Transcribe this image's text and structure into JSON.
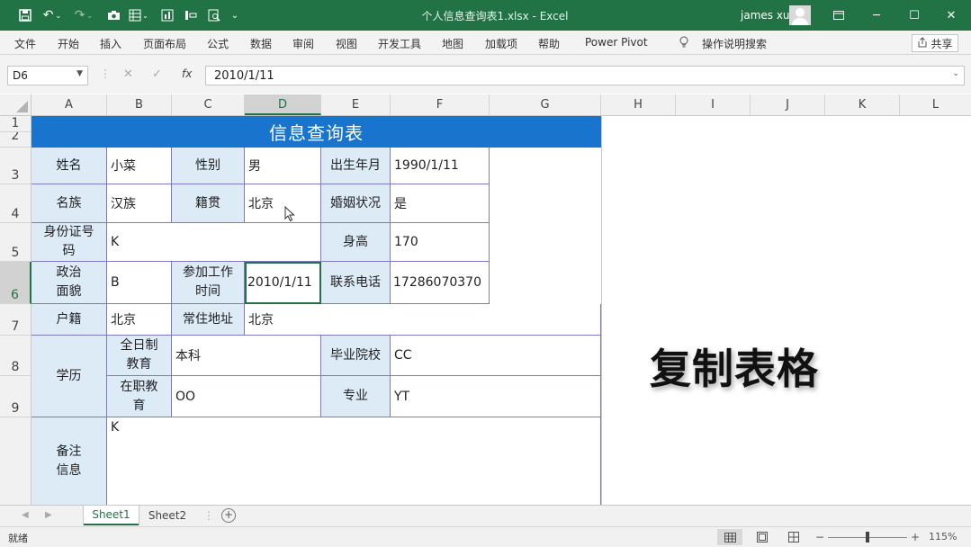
{
  "titlebar": {
    "doc_title": "个人信息查询表1.xlsx  -  Excel",
    "user": "james xu",
    "quick_access": [
      "save-icon",
      "undo-icon",
      "redo-icon",
      "camera-icon",
      "form-icon",
      "chart-icon",
      "columns-icon",
      "preview-icon",
      "customize-icon"
    ]
  },
  "menu": {
    "items": [
      "文件",
      "开始",
      "插入",
      "页面布局",
      "公式",
      "数据",
      "审阅",
      "视图",
      "开发工具",
      "地图",
      "加载项",
      "帮助",
      "Power Pivot"
    ],
    "tell_me": "操作说明搜索",
    "share": "共享"
  },
  "formula_bar": {
    "name_box": "D6",
    "formula": "2010/1/11"
  },
  "columns": [
    "A",
    "B",
    "C",
    "D",
    "E",
    "F",
    "G",
    "H",
    "I",
    "J",
    "K",
    "L"
  ],
  "rows": [
    "1",
    "2",
    "3",
    "4",
    "5",
    "6",
    "7",
    "8",
    "9"
  ],
  "sheet": {
    "title": "信息查询表",
    "name_label": "姓名",
    "name_value": "小菜",
    "gender_label": "性别",
    "gender_value": "男",
    "birth_label": "出生年月",
    "birth_value": "1990/1/11",
    "ethnic_label": "名族",
    "ethnic_value": "汉族",
    "native_label": "籍贯",
    "native_value": "北京",
    "marital_label": "婚姻状况",
    "marital_value": "是",
    "id_label": "身份证号码",
    "id_value": "K",
    "height_label": "身高",
    "height_value": "170",
    "political_label": "政治面貌",
    "political_value": "B",
    "workstart_label": "参加工作时间",
    "workstart_value": "2010/1/11",
    "phone_label": "联系电话",
    "phone_value": "17286070370",
    "household_label": "户籍",
    "household_value": "北京",
    "address_label": "常住地址",
    "address_value": "北京",
    "edu_label": "学历",
    "fulltime_label": "全日制教育",
    "fulltime_value": "本科",
    "school_label": "毕业院校",
    "school_value": "CC",
    "inservice_label": "在职教育",
    "inservice_value": "OO",
    "major_label": "专业",
    "major_value": "YT",
    "remark_label": "备注信息",
    "remark_value": "K"
  },
  "overlay_text": "复制表格",
  "tabs": [
    "Sheet1",
    "Sheet2"
  ],
  "active_tab": "Sheet1",
  "status": {
    "ready": "就绪",
    "zoom": "115%"
  }
}
